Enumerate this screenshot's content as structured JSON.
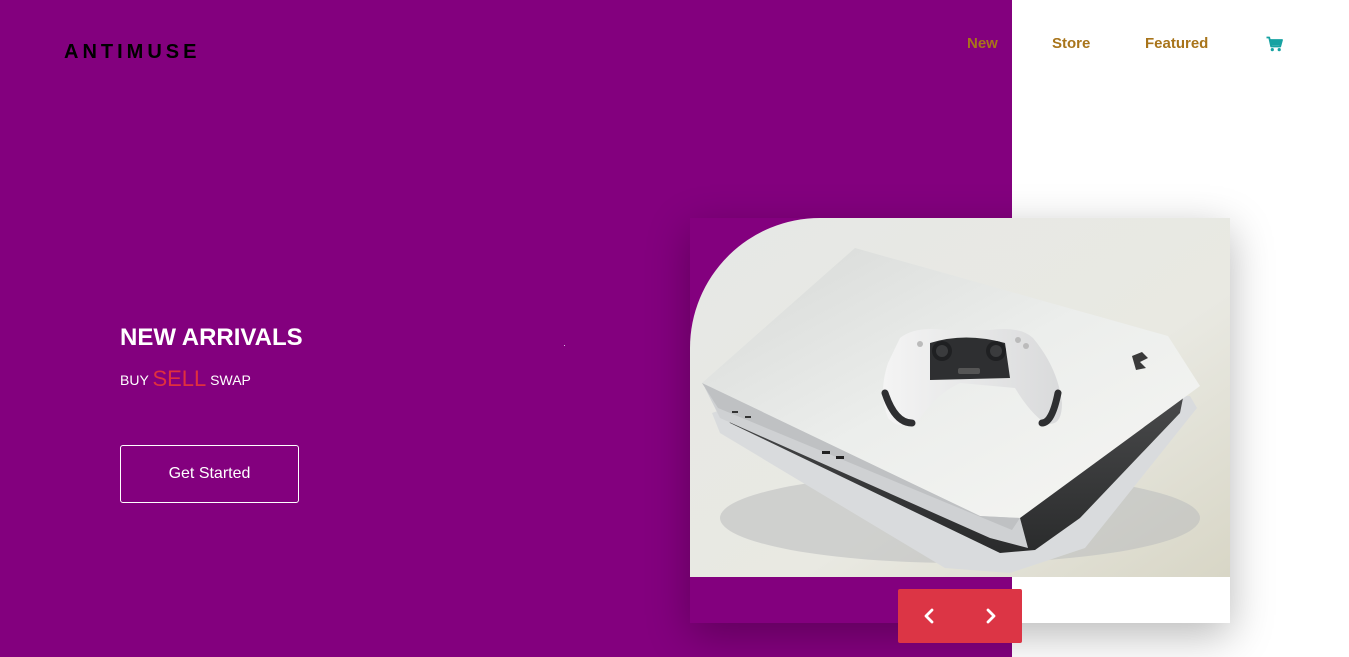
{
  "brand": {
    "logo_text": "ANTIMUSE"
  },
  "nav": {
    "items": [
      {
        "label": "New"
      },
      {
        "label": "Store"
      },
      {
        "label": "Featured"
      }
    ],
    "cart_icon": "shopping-cart-icon"
  },
  "hero": {
    "title": "NEW ARRIVALS",
    "subtitle": {
      "buy": "BUY",
      "sell": "SELL",
      "swap": "SWAP"
    },
    "cta_label": "Get Started"
  },
  "slider": {
    "image": "game-console-with-controller",
    "prev_icon": "chevron-left-icon",
    "next_icon": "chevron-right-icon"
  },
  "colors": {
    "primary_purple": "#83007e",
    "nav_gold": "#a8741a",
    "accent_red": "#dc3545",
    "sell_red": "#e0303e",
    "cart_teal": "#17a2a2"
  }
}
